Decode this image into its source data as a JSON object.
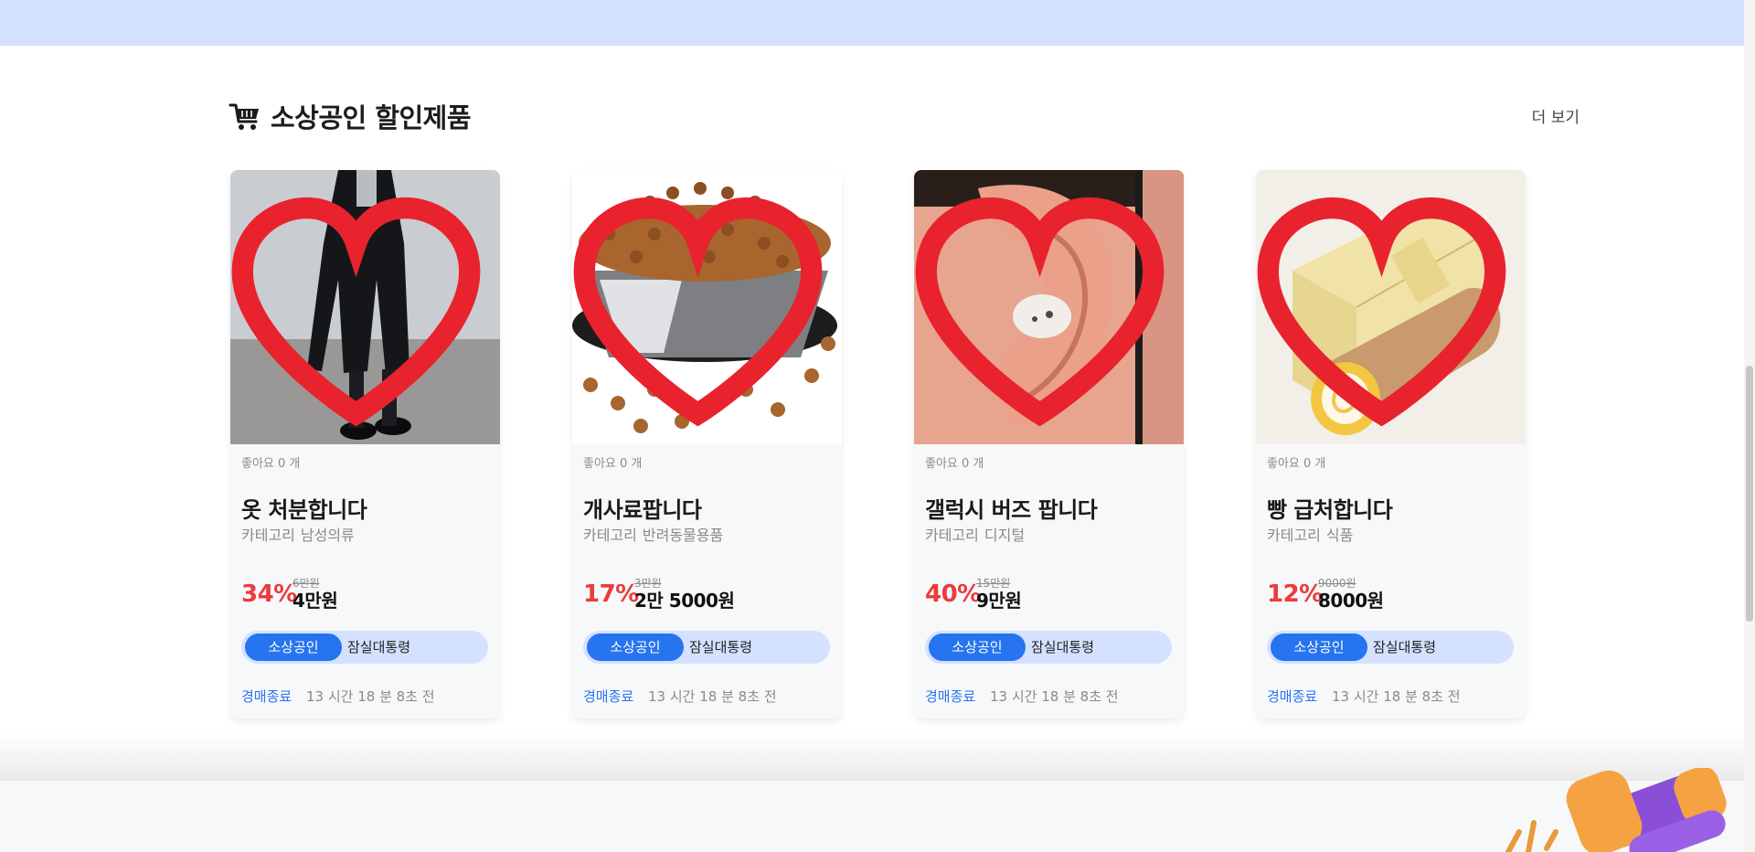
{
  "section": {
    "title": "소상공인 할인제품",
    "icon": "shopping-cart-icon",
    "more_label": "더 보기"
  },
  "products": [
    {
      "likes_label": "좋아요 0 개",
      "title": "옷 처분합니다",
      "category_label": "카테고리",
      "category": "남성의류",
      "discount": "34%",
      "original_price": "6만원",
      "sale_price": "4만원",
      "badge": "소상공인",
      "location": "잠실대통령",
      "status": "경매종료",
      "time_ago": "13 시간 18 분 8초 전",
      "image": "black-coat-photo"
    },
    {
      "likes_label": "좋아요 0 개",
      "title": "개사료팝니다",
      "category_label": "카테고리",
      "category": "반려동물용품",
      "discount": "17%",
      "original_price": "3만원",
      "sale_price": "2만 5000원",
      "badge": "소상공인",
      "location": "잠실대통령",
      "status": "경매종료",
      "time_ago": "13 시간 18 분 8초 전",
      "image": "dog-food-bowl-photo"
    },
    {
      "likes_label": "좋아요 0 개",
      "title": "갤럭시 버즈 팝니다",
      "category_label": "카테고리",
      "category": "디지털",
      "discount": "40%",
      "original_price": "15만원",
      "sale_price": "9만원",
      "badge": "소상공인",
      "location": "잠실대통령",
      "status": "경매종료",
      "time_ago": "13 시간 18 분 8초 전",
      "image": "earbud-in-ear-photo"
    },
    {
      "likes_label": "좋아요 0 개",
      "title": "빵 급처합니다",
      "category_label": "카테고리",
      "category": "식품",
      "discount": "12%",
      "original_price": "9000원",
      "sale_price": "8000원",
      "badge": "소상공인",
      "location": "잠실대통령",
      "status": "경매종료",
      "time_ago": "13 시간 18 분 8초 전",
      "image": "roll-cake-photo"
    }
  ],
  "colors": {
    "accent": "#2674ef",
    "discount": "#ec3b3b",
    "heart": "#e8232e",
    "band": "#d4e1ff"
  }
}
